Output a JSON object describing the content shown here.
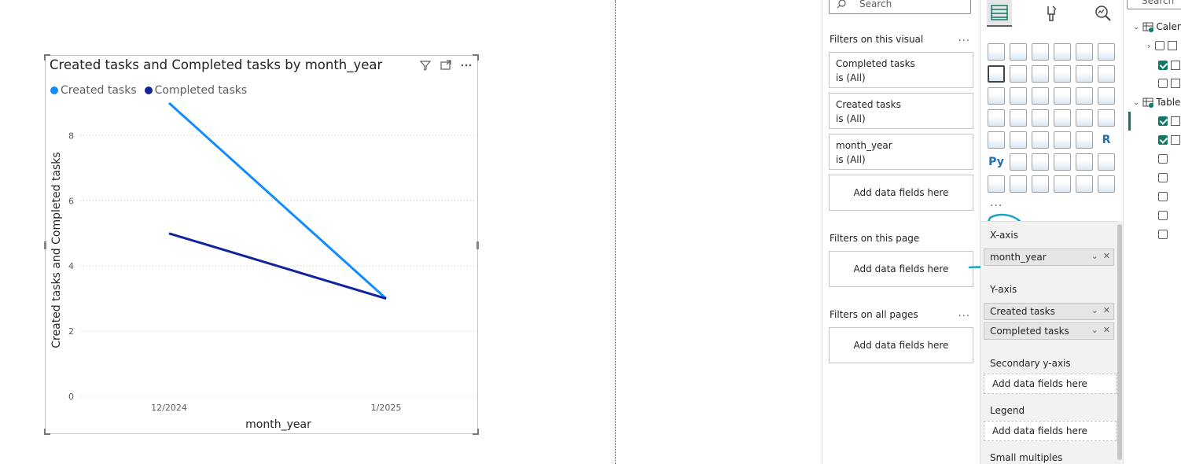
{
  "visual": {
    "title": "Created tasks and Completed tasks by month_year",
    "legend": [
      {
        "name": "Created tasks",
        "color": "#118DFF"
      },
      {
        "name": "Completed tasks",
        "color": "#12239E"
      }
    ],
    "tools": [
      "filter-icon",
      "focus-mode-icon",
      "more-options-icon"
    ]
  },
  "chart_data": {
    "type": "line",
    "title": "Created tasks and Completed tasks by month_year",
    "categories": [
      "12/2024",
      "1/2025"
    ],
    "series": [
      {
        "name": "Created tasks",
        "values": [
          9,
          3
        ],
        "color": "#118DFF"
      },
      {
        "name": "Completed tasks",
        "values": [
          5,
          3
        ],
        "color": "#12239E"
      }
    ],
    "xlabel": "month_year",
    "ylabel": "Created tasks and Completed tasks",
    "ylim": [
      0,
      9
    ],
    "yticks": [
      0,
      2,
      4,
      6,
      8
    ],
    "grid": true,
    "legend_position": "top-left"
  },
  "filters": {
    "search_placeholder": "Search",
    "on_visual_label": "Filters on this visual",
    "on_page_label": "Filters on this page",
    "on_all_pages_label": "Filters on all pages",
    "more": "...",
    "visual_filters": [
      {
        "field": "Completed tasks",
        "state": "is (All)"
      },
      {
        "field": "Created tasks",
        "state": "is (All)"
      },
      {
        "field": "month_year",
        "state": "is (All)"
      }
    ],
    "add_fields": "Add data fields here"
  },
  "viz": {
    "more": "...",
    "python_label": "Py",
    "r_label": "R",
    "wells": {
      "x_axis_label": "X-axis",
      "x_axis_fields": [
        "month_year"
      ],
      "y_axis_label": "Y-axis",
      "y_axis_fields": [
        "Created tasks",
        "Completed tasks"
      ],
      "secondary_label": "Secondary y-axis",
      "legend_label": "Legend",
      "small_multiples_label": "Small multiples",
      "add_fields": "Add data fields here"
    }
  },
  "data_pane": {
    "search_placeholder": "Search",
    "tables": [
      {
        "name": "Calendar"
      },
      {
        "name": "Table"
      }
    ]
  }
}
